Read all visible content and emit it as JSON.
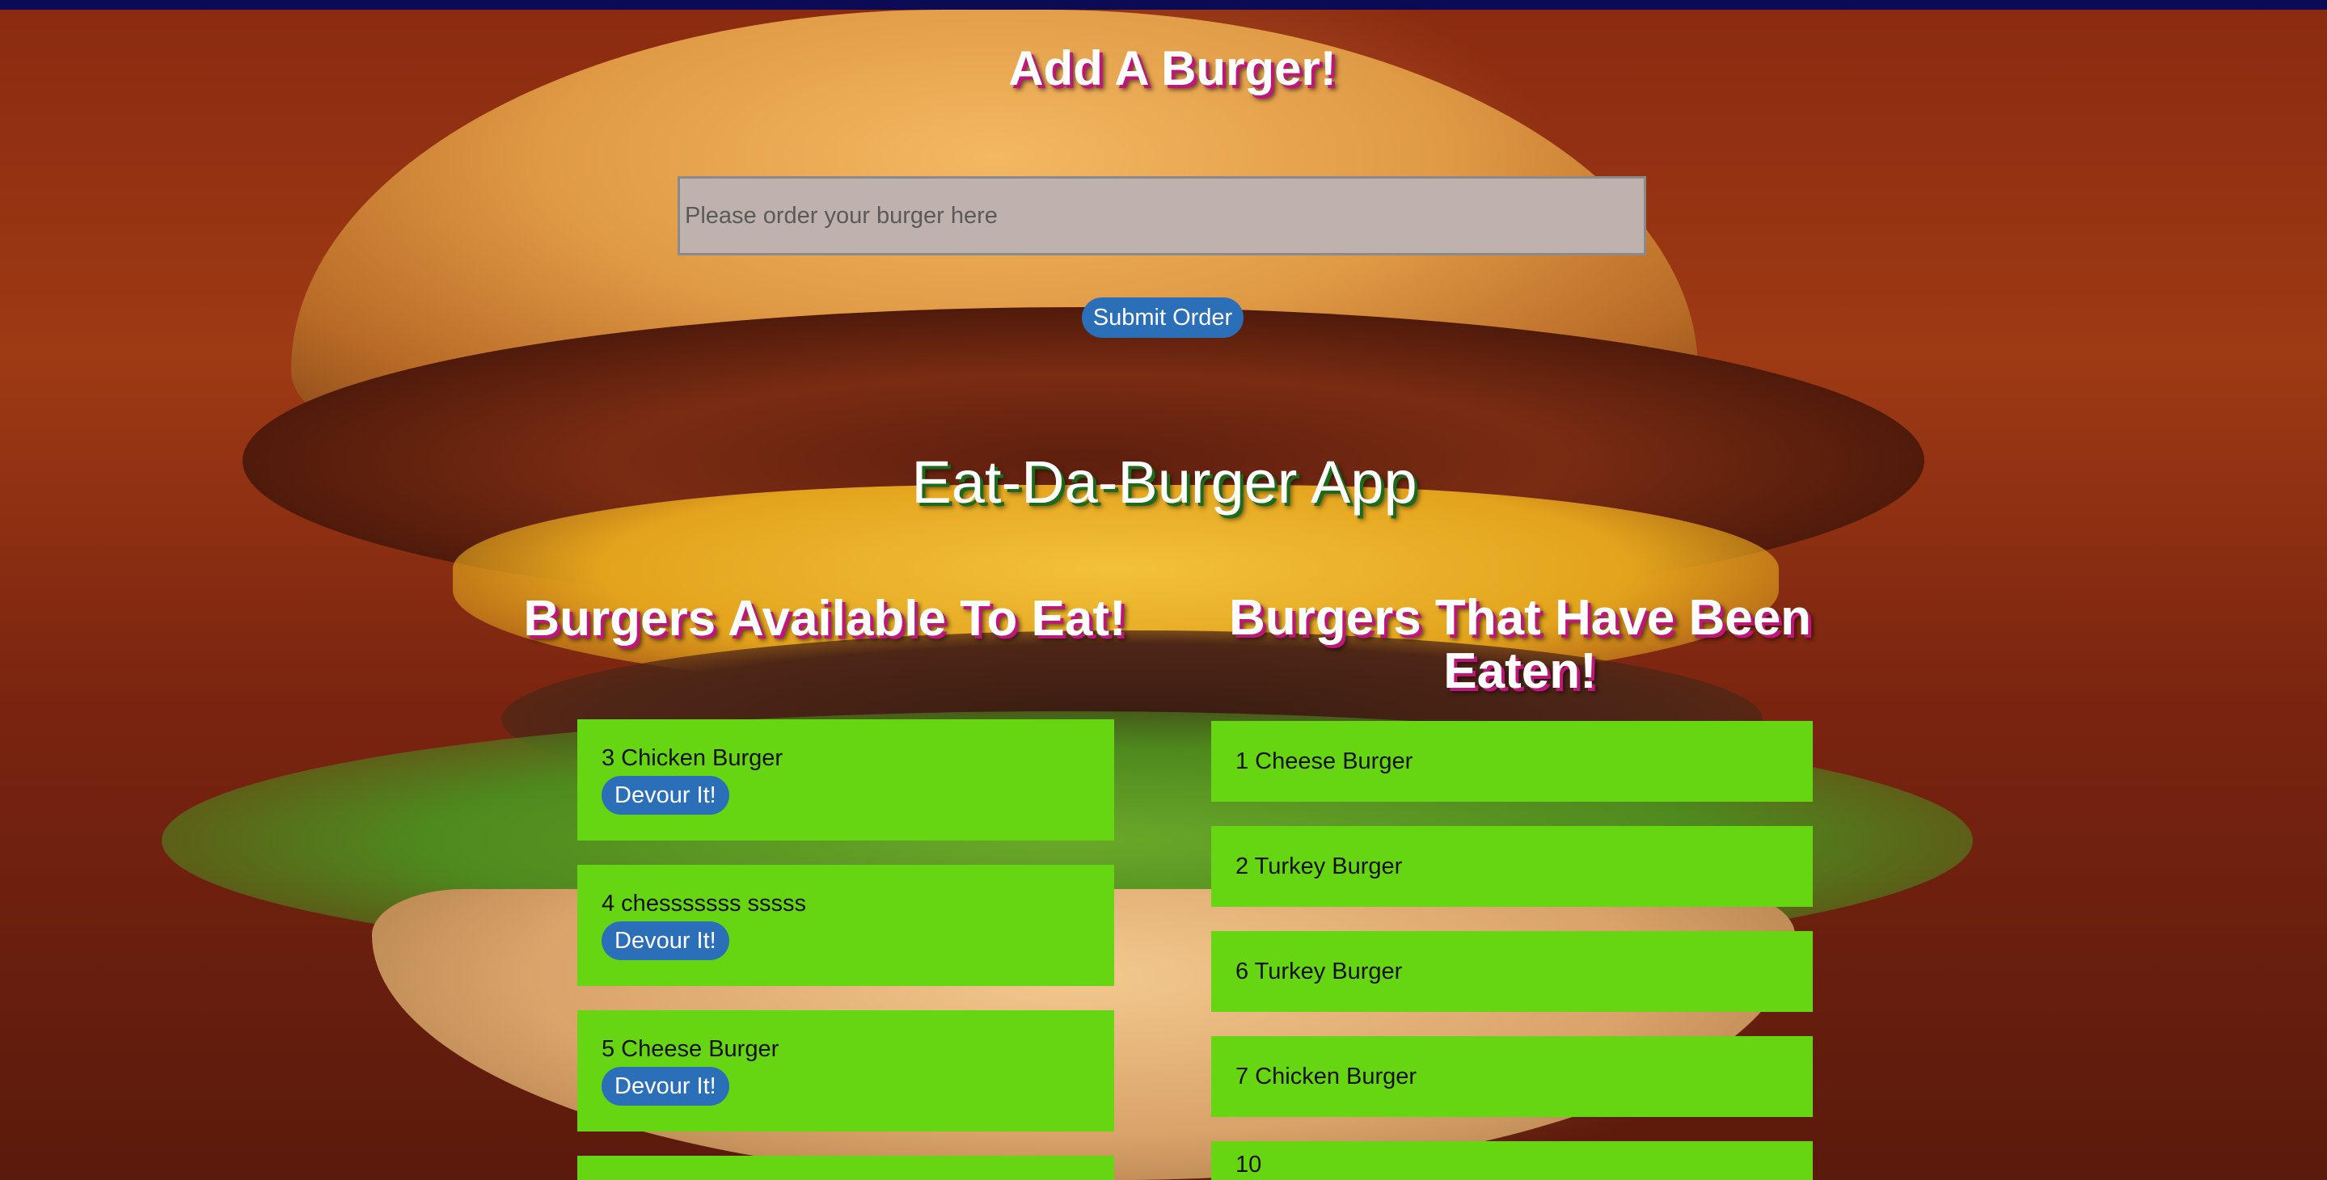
{
  "add_section": {
    "title": "Add A Burger!",
    "input_placeholder": "Please order your burger here",
    "input_value": "",
    "submit_label": "Submit Order"
  },
  "app_title": "Eat-Da-Burger App",
  "available": {
    "title": "Burgers Available To Eat!",
    "devour_label": "Devour It!",
    "items": [
      {
        "label": "3 Chicken Burger"
      },
      {
        "label": "4 chesssssss sssss"
      },
      {
        "label": "5 Cheese Burger"
      },
      {
        "label": ""
      }
    ]
  },
  "eaten": {
    "title": "Burgers That Have Been Eaten!",
    "items": [
      {
        "label": "1 Cheese Burger"
      },
      {
        "label": "2 Turkey Burger"
      },
      {
        "label": "6 Turkey Burger"
      },
      {
        "label": "7 Chicken Burger"
      },
      {
        "label": "10"
      }
    ]
  },
  "colors": {
    "top_bar": "#0b0b55",
    "card_green": "#66d612",
    "button_blue": "#2a6fb8",
    "input_bg": "#bfb1ae",
    "heading_shadow_pink": "#c0157a",
    "app_title_shadow_green": "#1b6b1b"
  }
}
